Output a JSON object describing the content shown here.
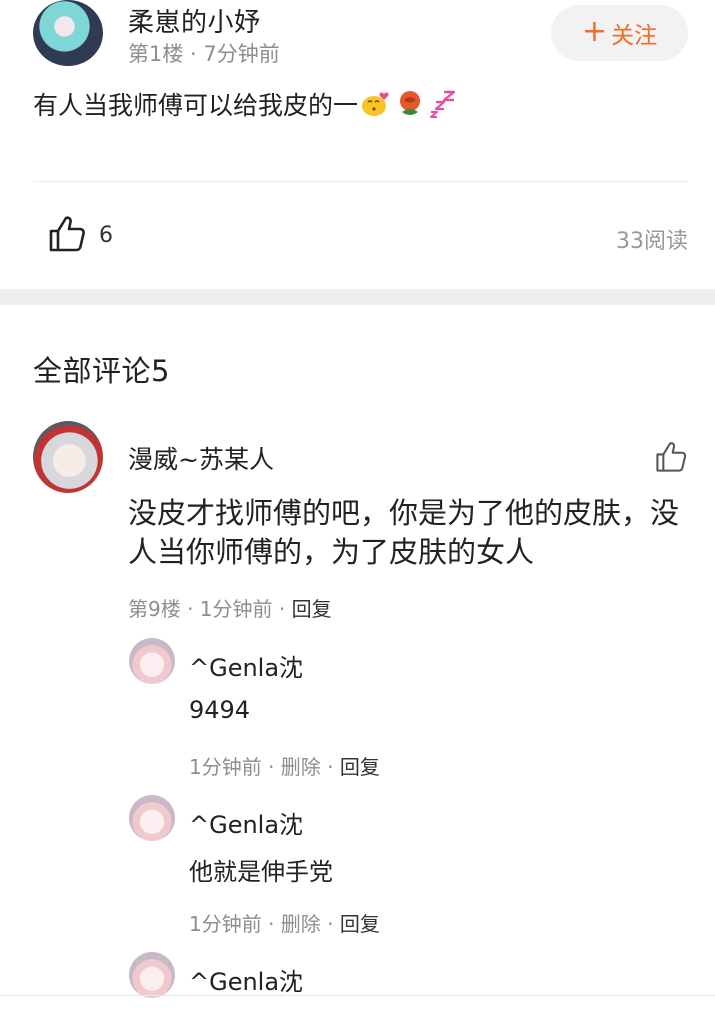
{
  "post": {
    "author": "柔崽的小妤",
    "meta": "第1楼 · 7分钟前",
    "follow_label": "关注",
    "text": "有人当我师傅可以给我皮的一",
    "likes": "6",
    "reads": "33阅读"
  },
  "comments_title": "全部评论5",
  "comment": {
    "author": "漫威~苏某人",
    "text": "没皮才找师傅的吧，你是为了他的皮肤，没人当你师傅的，为了皮肤的女人",
    "meta_prefix": "第9楼 · 1分钟前 · ",
    "reply_label": "回复",
    "replies": [
      {
        "author": "^Genla沈",
        "text": "9494",
        "time": "1分钟前 · ",
        "delete": "删除",
        "sep": " · ",
        "reply": "回复"
      },
      {
        "author": "^Genla沈",
        "text": "他就是伸手党",
        "time": "1分钟前 · ",
        "delete": "删除",
        "sep": " · ",
        "reply": "回复"
      },
      {
        "author": "^Genla沈"
      }
    ]
  },
  "colors": {
    "accent": "#f06b2c",
    "meta": "#8e8e8e",
    "gap": "#efefef"
  },
  "icons": [
    "thumbs-up-icon",
    "plus-icon",
    "kiss-emoji",
    "rose-emoji",
    "sleep-emoji"
  ]
}
